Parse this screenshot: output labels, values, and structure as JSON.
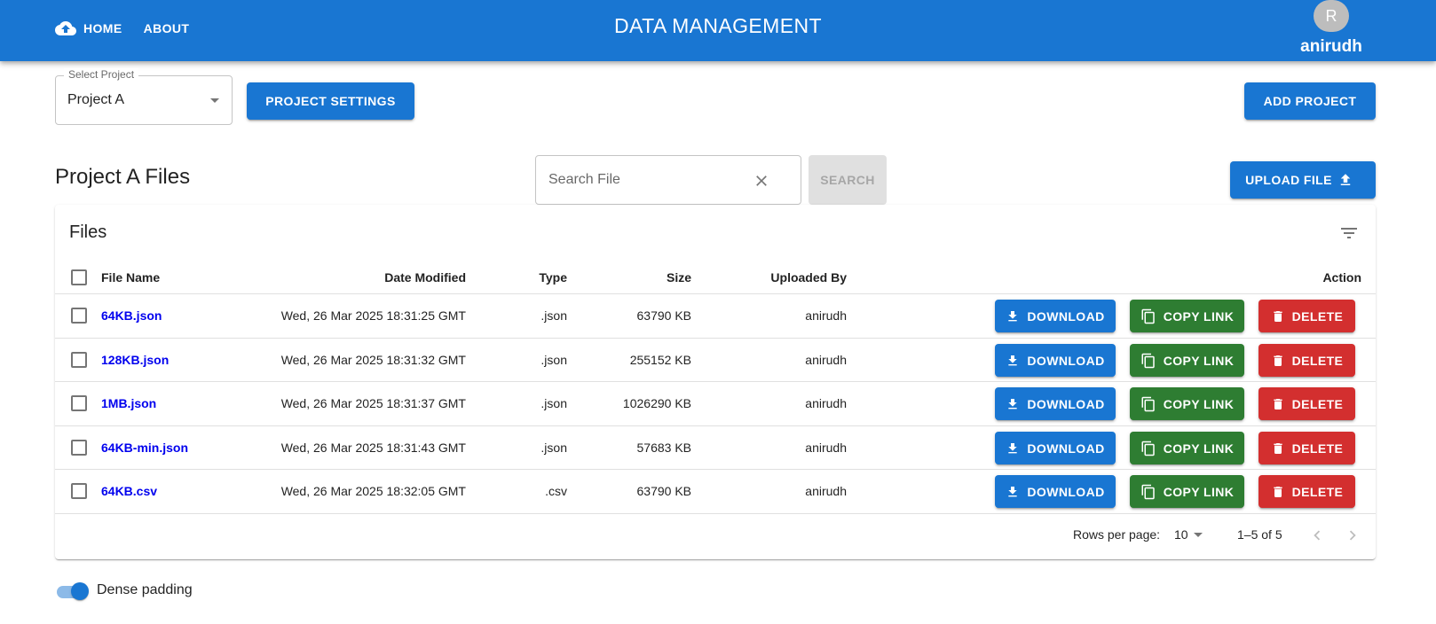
{
  "header": {
    "nav_home": "HOME",
    "nav_about": "ABOUT",
    "title": "DATA MANAGEMENT",
    "avatar_initial": "R",
    "username": "anirudh"
  },
  "project_select": {
    "label": "Select Project",
    "value": "Project A"
  },
  "buttons": {
    "project_settings": "PROJECT SETTINGS",
    "add_project": "ADD PROJECT",
    "upload_file": "UPLOAD FILE",
    "search": "SEARCH"
  },
  "section_title": "Project A Files",
  "search": {
    "placeholder": "Search File",
    "value": ""
  },
  "table": {
    "title": "Files",
    "columns": {
      "file_name": "File Name",
      "date_modified": "Date Modified",
      "type": "Type",
      "size": "Size",
      "uploaded_by": "Uploaded By",
      "action": "Action"
    },
    "action_labels": {
      "download": "DOWNLOAD",
      "copy_link": "COPY LINK",
      "delete": "DELETE"
    },
    "rows": [
      {
        "name": "64KB.json",
        "date": "Wed, 26 Mar 2025 18:31:25 GMT",
        "type": ".json",
        "size": "63790 KB",
        "uploaded_by": "anirudh"
      },
      {
        "name": "128KB.json",
        "date": "Wed, 26 Mar 2025 18:31:32 GMT",
        "type": ".json",
        "size": "255152 KB",
        "uploaded_by": "anirudh"
      },
      {
        "name": "1MB.json",
        "date": "Wed, 26 Mar 2025 18:31:37 GMT",
        "type": ".json",
        "size": "1026290 KB",
        "uploaded_by": "anirudh"
      },
      {
        "name": "64KB-min.json",
        "date": "Wed, 26 Mar 2025 18:31:43 GMT",
        "type": ".json",
        "size": "57683 KB",
        "uploaded_by": "anirudh"
      },
      {
        "name": "64KB.csv",
        "date": "Wed, 26 Mar 2025 18:32:05 GMT",
        "type": ".csv",
        "size": "63790 KB",
        "uploaded_by": "anirudh"
      }
    ]
  },
  "pagination": {
    "rows_per_page_label": "Rows per page:",
    "rows_per_page": "10",
    "range": "1–5 of 5"
  },
  "dense_padding": {
    "label": "Dense padding",
    "checked": true
  },
  "colors": {
    "primary": "#1976d2",
    "success": "#2e7d32",
    "error": "#d32f2f",
    "link": "#0000ee"
  },
  "icons": {
    "logo": "cloud-upload-icon",
    "select": "arrow-drop-down-icon",
    "clear": "close-icon",
    "upload": "upload-icon",
    "filter": "filter-list-icon",
    "download": "download-icon",
    "copy": "content-copy-icon",
    "delete": "trash-icon",
    "prev": "chevron-left-icon",
    "next": "chevron-right-icon"
  }
}
